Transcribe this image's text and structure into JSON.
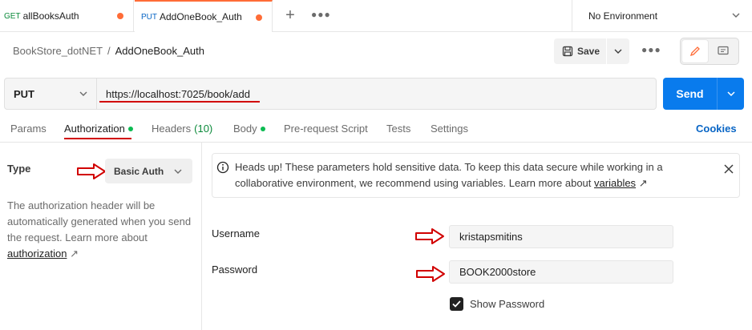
{
  "tabs": [
    {
      "method": "GET",
      "name": "allBooksAuth",
      "unsaved": true
    },
    {
      "method": "PUT",
      "name": "AddOneBook_Auth",
      "unsaved": true
    }
  ],
  "environment": {
    "label": "No Environment"
  },
  "breadcrumb": {
    "parent": "BookStore_dotNET",
    "separator": "/",
    "current": "AddOneBook_Auth"
  },
  "toolbar": {
    "save_label": "Save"
  },
  "request": {
    "method": "PUT",
    "url": "https://localhost:7025/book/add",
    "send_label": "Send"
  },
  "request_tabs": [
    {
      "label": "Params"
    },
    {
      "label": "Authorization",
      "active": true,
      "dot": true
    },
    {
      "label": "Headers",
      "count": "(10)"
    },
    {
      "label": "Body",
      "dot": true
    },
    {
      "label": "Pre-request Script"
    },
    {
      "label": "Tests"
    },
    {
      "label": "Settings"
    }
  ],
  "cookies_label": "Cookies",
  "auth": {
    "type_label": "Type",
    "type_value": "Basic Auth",
    "description": "The authorization header will be automatically generated when you send the request. Learn more about",
    "description_link": "authorization",
    "link_arrow": "↗"
  },
  "notice": {
    "text": "Heads up! These parameters hold sensitive data. To keep this data secure while working in a collaborative environment, we recommend using variables. Learn more about",
    "link": "variables",
    "link_arrow": "↗"
  },
  "fields": {
    "username_label": "Username",
    "username_value": "kristapsmitins",
    "password_label": "Password",
    "password_value": "BOOK2000store",
    "show_password_label": "Show Password",
    "show_password_checked": true
  },
  "colors": {
    "accent": "#ff6c37",
    "send": "#097bed",
    "annotation": "#d10000",
    "status_dot": "#0cbb52"
  }
}
